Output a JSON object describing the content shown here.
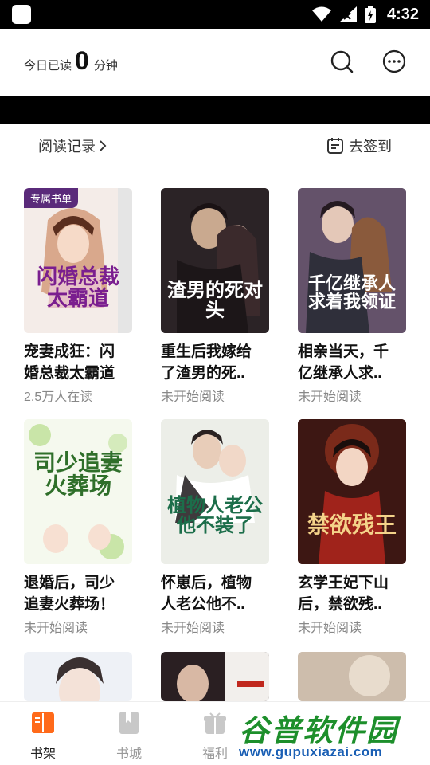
{
  "status_bar": {
    "time": "4:32",
    "icons": [
      "app-square-icon",
      "wifi-icon",
      "signal-icon",
      "battery-icon"
    ]
  },
  "header": {
    "today_prefix": "今日已读",
    "today_count": "0",
    "today_unit": "分钟",
    "icons": [
      "search-icon",
      "more-icon"
    ]
  },
  "shelf": {
    "reading_record": "阅读记录",
    "checkin": "去签到"
  },
  "books": [
    {
      "badge": "专属书单",
      "cover_text": "闪婚总裁太霸道",
      "title_l1": "宠妻成狂：闪",
      "title_l2": "婚总裁太霸道",
      "status": "2.5万人在读"
    },
    {
      "badge": "",
      "cover_text": "渣男的死对头",
      "title_l1": "重生后我嫁给",
      "title_l2": "了渣男的死..",
      "status": "未开始阅读"
    },
    {
      "badge": "",
      "cover_text": "千亿继承人求着我领证",
      "title_l1": "相亲当天，千",
      "title_l2": "亿继承人求..",
      "status": "未开始阅读"
    },
    {
      "badge": "",
      "cover_text": "司少追妻火葬场",
      "title_l1": "退婚后，司少",
      "title_l2": "追妻火葬场！",
      "status": "未开始阅读"
    },
    {
      "badge": "",
      "cover_text": "植物人老公他不装了",
      "title_l1": "怀崽后，植物",
      "title_l2": "人老公他不..",
      "status": "未开始阅读"
    },
    {
      "badge": "",
      "cover_text": "禁欲残王",
      "title_l1": "玄学王妃下山",
      "title_l2": "后，禁欲残..",
      "status": "未开始阅读"
    }
  ],
  "bottom_nav": [
    {
      "label": "书架",
      "icon": "bookshelf-icon",
      "active": true
    },
    {
      "label": "书城",
      "icon": "bookstore-icon",
      "active": false
    },
    {
      "label": "福利",
      "icon": "gift-icon",
      "active": false
    }
  ],
  "watermark": {
    "title": "谷普软件园",
    "url": "www.gupuxiazai.com"
  },
  "colors": {
    "accent": "#ff6a1a",
    "badge": "#5a2a7a",
    "muted": "#888888",
    "watermark_green": "#1d8f2b",
    "watermark_blue": "#1a5fb4"
  }
}
